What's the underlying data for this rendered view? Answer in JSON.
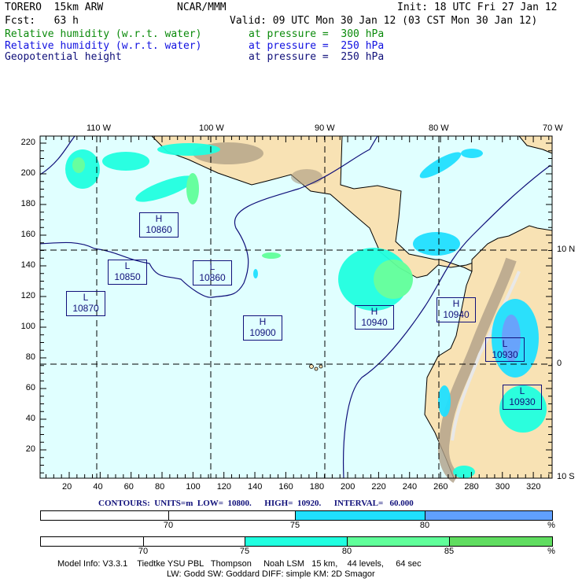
{
  "header": {
    "model": "TORERO  15km ARW",
    "org": "NCAR/MMM",
    "init": "Init: 18 UTC Fri 27 Jan 12",
    "fcst": "Fcst:   63 h",
    "valid": "Valid: 09 UTC Mon 30 Jan 12 (03 CST Mon 30 Jan 12)",
    "fields": [
      {
        "name": "Relative humidity (w.r.t. water)",
        "level": "at pressure =  300 hPa",
        "color": "#0a8a0a"
      },
      {
        "name": "Relative humidity (w.r.t. water)",
        "level": "at pressure =  250 hPa",
        "color": "#1010e0"
      },
      {
        "name": "Geopotential height",
        "level": "at pressure =  250 hPa",
        "color": "#10107a"
      }
    ]
  },
  "map": {
    "x_ticks": [
      "20",
      "40",
      "60",
      "80",
      "100",
      "120",
      "140",
      "160",
      "180",
      "200",
      "220",
      "240",
      "260",
      "280",
      "300",
      "320"
    ],
    "y_ticks": [
      "20",
      "40",
      "60",
      "80",
      "100",
      "120",
      "140",
      "160",
      "180",
      "200",
      "220"
    ],
    "lon_labels": [
      "110 W",
      "100 W",
      "90 W",
      "80 W",
      "70 W"
    ],
    "lat_labels": [
      "10 N",
      "0",
      "10 S"
    ],
    "centers": [
      {
        "type": "H",
        "value": "10860"
      },
      {
        "type": "L",
        "value": "10850"
      },
      {
        "type": "L",
        "value": "10860"
      },
      {
        "type": "L",
        "value": "10870"
      },
      {
        "type": "H",
        "value": "10900"
      },
      {
        "type": "H",
        "value": "10940"
      },
      {
        "type": "H",
        "value": "10940"
      },
      {
        "type": "L",
        "value": "10930"
      },
      {
        "type": "L",
        "value": "10930"
      }
    ],
    "colors": {
      "ocean": "#e0ffff",
      "land": "#f8e2b4",
      "contour": "#10107a"
    }
  },
  "contours_info": "CONTOURS:  UNITS=m  LOW=  10800.      HIGH=  10920.      INTERVAL=   60.000",
  "colorbar_250": {
    "labels": [
      "70",
      "75",
      "80",
      "%"
    ],
    "colors": [
      "#ffffff",
      "#ffffff",
      "#20e0ff",
      "#60a0ff"
    ]
  },
  "colorbar_300": {
    "labels": [
      "70",
      "75",
      "80",
      "85",
      "%"
    ],
    "colors": [
      "#ffffff",
      "#ffffff",
      "#20ffe0",
      "#60ff9a",
      "#60dd60"
    ]
  },
  "footer": {
    "line1": "Model Info: V3.3.1    Tiedtke YSU PBL   Thompson     Noah LSM   15 km,    44 levels,     64 sec",
    "line2": "LW: Godd SW: Goddard DIFF: simple KM: 2D Smagor"
  }
}
